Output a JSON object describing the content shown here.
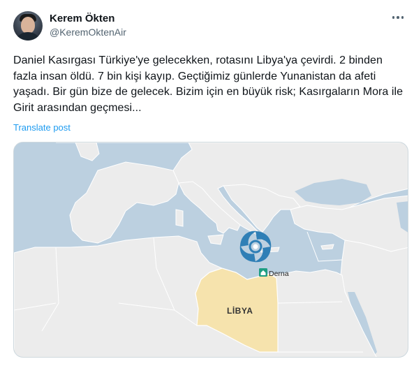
{
  "author": {
    "display_name": "Kerem Ökten",
    "handle": "@KeremOktenAir"
  },
  "icons": {
    "more": "more-horizontal-icon",
    "hurricane": "hurricane-icon",
    "city_marker": "house-marker-icon"
  },
  "tweet": {
    "text": "Daniel Kasırgası Türkiye'ye gelecekken, rotasını Libya'ya çevirdi. 2 binden fazla insan öldü. 7 bin kişi kayıp. Geçtiğimiz günlerde Yunanistan da afeti yaşadı. Bir gün bize de gelecek. Bizim için en büyük risk; Kasırgaların Mora ile Girit arasından geçmesi...",
    "translate_label": "Translate post"
  },
  "map": {
    "country_label": "LİBYA",
    "city_label": "Derna",
    "colors": {
      "sea": "#bcd0e0",
      "land": "#ececec",
      "highlight": "#f6e3ad",
      "border": "#ffffff",
      "hurricane": "#2f7fb6",
      "marker": "#1e9e82"
    }
  },
  "colors": {
    "text": "#0f1419",
    "secondary": "#536471",
    "link": "#1d9bf0",
    "card_border": "#cfd9de"
  }
}
